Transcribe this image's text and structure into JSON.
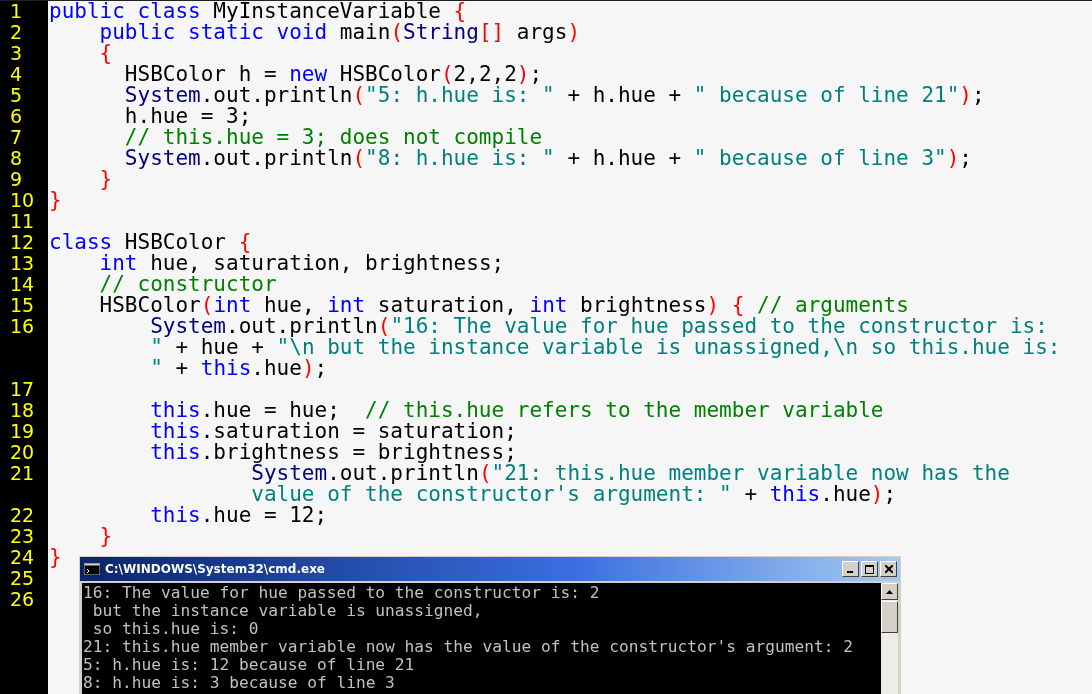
{
  "editor": {
    "lines": [
      {
        "number": "1",
        "tokens": [
          {
            "kind": "keyword",
            "text": "public class"
          },
          {
            "kind": "plain",
            "text": " MyInstanceVariable "
          },
          {
            "kind": "bracket",
            "text": "{"
          }
        ]
      },
      {
        "number": "2",
        "tokens": [
          {
            "kind": "keyword",
            "text": "    public static void"
          },
          {
            "kind": "plain",
            "text": " main"
          },
          {
            "kind": "bracket",
            "text": "("
          },
          {
            "kind": "type",
            "text": "String"
          },
          {
            "kind": "bracket",
            "text": "[]"
          },
          {
            "kind": "plain",
            "text": " args"
          },
          {
            "kind": "bracket",
            "text": ")"
          }
        ]
      },
      {
        "number": "3",
        "tokens": [
          {
            "kind": "bracket",
            "text": "    {"
          }
        ]
      },
      {
        "number": "4",
        "tokens": [
          {
            "kind": "plain",
            "text": "      HSBColor h = "
          },
          {
            "kind": "keyword",
            "text": "new"
          },
          {
            "kind": "plain",
            "text": " HSBColor"
          },
          {
            "kind": "bracket",
            "text": "("
          },
          {
            "kind": "plain",
            "text": "2,2,2"
          },
          {
            "kind": "bracket",
            "text": ")"
          },
          {
            "kind": "plain",
            "text": ";"
          }
        ]
      },
      {
        "number": "5",
        "tokens": [
          {
            "kind": "type",
            "text": "      System"
          },
          {
            "kind": "plain",
            "text": ".out.println"
          },
          {
            "kind": "bracket",
            "text": "("
          },
          {
            "kind": "string",
            "text": "\"5: h.hue is: \""
          },
          {
            "kind": "plain",
            "text": " + h.hue + "
          },
          {
            "kind": "string",
            "text": "\" because of line 21\""
          },
          {
            "kind": "bracket",
            "text": ")"
          },
          {
            "kind": "plain",
            "text": ";"
          }
        ]
      },
      {
        "number": "6",
        "tokens": [
          {
            "kind": "plain",
            "text": "      h.hue = 3;"
          }
        ]
      },
      {
        "number": "7",
        "tokens": [
          {
            "kind": "comment",
            "text": "      // this.hue = 3; does not compile"
          }
        ]
      },
      {
        "number": "8",
        "tokens": [
          {
            "kind": "type",
            "text": "      System"
          },
          {
            "kind": "plain",
            "text": ".out.println"
          },
          {
            "kind": "bracket",
            "text": "("
          },
          {
            "kind": "string",
            "text": "\"8: h.hue is: \""
          },
          {
            "kind": "plain",
            "text": " + h.hue + "
          },
          {
            "kind": "string",
            "text": "\" because of line 3\""
          },
          {
            "kind": "bracket",
            "text": ")"
          },
          {
            "kind": "plain",
            "text": ";"
          }
        ]
      },
      {
        "number": "9",
        "tokens": [
          {
            "kind": "bracket",
            "text": "    }"
          }
        ]
      },
      {
        "number": "10",
        "tokens": [
          {
            "kind": "bracket",
            "text": "}"
          }
        ]
      },
      {
        "number": "11"
      },
      {
        "number": "12",
        "tokens": [
          {
            "kind": "keyword",
            "text": "class"
          },
          {
            "kind": "plain",
            "text": " HSBColor "
          },
          {
            "kind": "bracket",
            "text": "{"
          }
        ]
      },
      {
        "number": "13",
        "tokens": [
          {
            "kind": "keyword",
            "text": "    int"
          },
          {
            "kind": "plain",
            "text": " hue, saturation, brightness;"
          }
        ]
      },
      {
        "number": "14",
        "tokens": [
          {
            "kind": "comment",
            "text": "    // constructor"
          }
        ]
      },
      {
        "number": "15",
        "tokens": [
          {
            "kind": "plain",
            "text": "    HSBColor"
          },
          {
            "kind": "bracket",
            "text": "("
          },
          {
            "kind": "keyword",
            "text": "int"
          },
          {
            "kind": "plain",
            "text": " hue, "
          },
          {
            "kind": "keyword",
            "text": "int"
          },
          {
            "kind": "plain",
            "text": " saturation, "
          },
          {
            "kind": "keyword",
            "text": "int"
          },
          {
            "kind": "plain",
            "text": " brightness"
          },
          {
            "kind": "bracket",
            "text": ")"
          },
          {
            "kind": "bracket",
            "text": " {"
          },
          {
            "kind": "comment",
            "text": " // arguments"
          }
        ]
      },
      {
        "number": "16",
        "tokens": [
          {
            "kind": "type",
            "text": "        System"
          },
          {
            "kind": "plain",
            "text": ".out.println"
          },
          {
            "kind": "bracket",
            "text": "("
          },
          {
            "kind": "string",
            "text": "\"16: The value for hue passed to the constructor is:"
          }
        ]
      },
      {
        "tokens": [
          {
            "kind": "string",
            "text": "        \""
          },
          {
            "kind": "plain",
            "text": " + hue + "
          },
          {
            "kind": "string",
            "text": "\"\\n but the instance variable is unassigned,\\n so this.hue is:"
          }
        ]
      },
      {
        "tokens": [
          {
            "kind": "string",
            "text": "        \""
          },
          {
            "kind": "plain",
            "text": " + "
          },
          {
            "kind": "keyword",
            "text": "this"
          },
          {
            "kind": "plain",
            "text": ".hue"
          },
          {
            "kind": "bracket",
            "text": ")"
          },
          {
            "kind": "plain",
            "text": ";"
          }
        ]
      },
      {
        "number": "17"
      },
      {
        "number": "18",
        "tokens": [
          {
            "kind": "keyword",
            "text": "        this"
          },
          {
            "kind": "plain",
            "text": ".hue = hue;"
          },
          {
            "kind": "comment",
            "text": "  // this.hue refers to the member variable"
          }
        ]
      },
      {
        "number": "19",
        "tokens": [
          {
            "kind": "keyword",
            "text": "        this"
          },
          {
            "kind": "plain",
            "text": ".saturation = saturation;"
          }
        ]
      },
      {
        "number": "20",
        "tokens": [
          {
            "kind": "keyword",
            "text": "        this"
          },
          {
            "kind": "plain",
            "text": ".brightness = brightness;"
          }
        ]
      },
      {
        "number": "21",
        "tokens": [
          {
            "kind": "type",
            "text": "                System"
          },
          {
            "kind": "plain",
            "text": ".out.println"
          },
          {
            "kind": "bracket",
            "text": "("
          },
          {
            "kind": "string",
            "text": "\"21: this.hue member variable now has the"
          }
        ]
      },
      {
        "tokens": [
          {
            "kind": "string",
            "text": "                value of the constructor's argument: \""
          },
          {
            "kind": "plain",
            "text": " + "
          },
          {
            "kind": "keyword",
            "text": "this"
          },
          {
            "kind": "plain",
            "text": ".hue"
          },
          {
            "kind": "bracket",
            "text": ")"
          },
          {
            "kind": "plain",
            "text": ";"
          }
        ]
      },
      {
        "number": "22",
        "tokens": [
          {
            "kind": "keyword",
            "text": "        this"
          },
          {
            "kind": "plain",
            "text": ".hue = 12;"
          }
        ]
      },
      {
        "number": "23",
        "tokens": [
          {
            "kind": "bracket",
            "text": "    }"
          }
        ]
      },
      {
        "number": "24",
        "tokens": [
          {
            "kind": "bracket",
            "text": "}"
          }
        ]
      },
      {
        "number": "25"
      },
      {
        "number": "26"
      }
    ]
  },
  "console": {
    "title": "C:\\WINDOWS\\System32\\cmd.exe",
    "lines": [
      "16: The value for hue passed to the constructor is: 2",
      " but the instance variable is unassigned,",
      " so this.hue is: 0",
      "21: this.hue member variable now has the value of the constructor's argument: 2",
      "5: h.hue is: 12 because of line 21",
      "8: h.hue is: 3 because of line 3"
    ]
  }
}
